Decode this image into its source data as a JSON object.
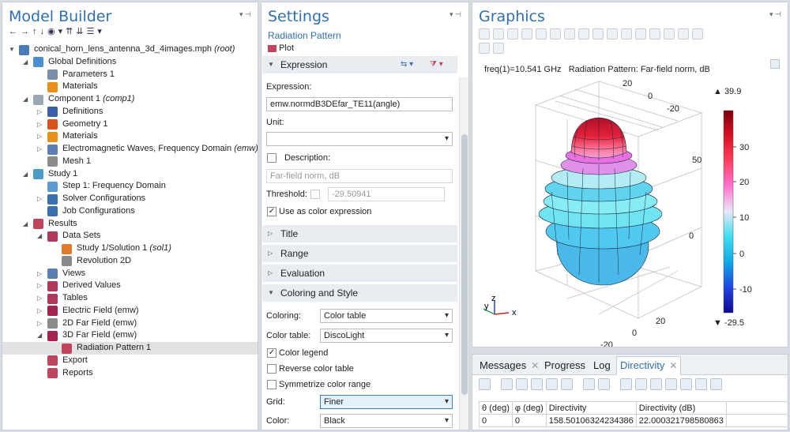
{
  "model_builder": {
    "title": "Model Builder",
    "tree": [
      {
        "indent": 0,
        "tw": "▼",
        "icon": "file-icon",
        "color": "#4a7ab8",
        "label": "conical_horn_lens_antenna_3d_4images.mph",
        "tag": "(root)"
      },
      {
        "indent": 1,
        "tw": "◢",
        "icon": "globe-icon",
        "color": "#4c8fd0",
        "label": "Global Definitions",
        "tag": ""
      },
      {
        "indent": 2,
        "tw": "",
        "icon": "parameters-icon",
        "color": "#7b8fa8",
        "label": "Parameters 1",
        "tag": ""
      },
      {
        "indent": 2,
        "tw": "",
        "icon": "materials-icon",
        "color": "#e8901a",
        "label": "Materials",
        "tag": ""
      },
      {
        "indent": 1,
        "tw": "◢",
        "icon": "component-icon",
        "color": "#9aa7b5",
        "label": "Component 1",
        "tag": "(comp1)"
      },
      {
        "indent": 2,
        "tw": "▷",
        "icon": "definitions-icon",
        "color": "#3c5fa8",
        "label": "Definitions",
        "tag": ""
      },
      {
        "indent": 2,
        "tw": "▷",
        "icon": "geometry-icon",
        "color": "#d9531e",
        "label": "Geometry 1",
        "tag": ""
      },
      {
        "indent": 2,
        "tw": "▷",
        "icon": "materials-icon",
        "color": "#e8901a",
        "label": "Materials",
        "tag": ""
      },
      {
        "indent": 2,
        "tw": "▷",
        "icon": "emw-icon",
        "color": "#5a7fb0",
        "label": "Electromagnetic Waves, Frequency Domain",
        "tag": "(emw)"
      },
      {
        "indent": 2,
        "tw": "",
        "icon": "mesh-icon",
        "color": "#8c8c8c",
        "label": "Mesh 1",
        "tag": ""
      },
      {
        "indent": 1,
        "tw": "◢",
        "icon": "study-icon",
        "color": "#4c9ac8",
        "label": "Study 1",
        "tag": ""
      },
      {
        "indent": 2,
        "tw": "",
        "icon": "step-icon",
        "color": "#5a9ad0",
        "label": "Step 1: Frequency Domain",
        "tag": ""
      },
      {
        "indent": 2,
        "tw": "▷",
        "icon": "solver-icon",
        "color": "#3c6fb0",
        "label": "Solver Configurations",
        "tag": ""
      },
      {
        "indent": 2,
        "tw": "",
        "icon": "job-icon",
        "color": "#3c6fb0",
        "label": "Job Configurations",
        "tag": ""
      },
      {
        "indent": 1,
        "tw": "◢",
        "icon": "results-icon",
        "color": "#c0455c",
        "label": "Results",
        "tag": ""
      },
      {
        "indent": 2,
        "tw": "◢",
        "icon": "datasets-icon",
        "color": "#b0385a",
        "label": "Data Sets",
        "tag": ""
      },
      {
        "indent": 3,
        "tw": "",
        "icon": "solution-icon",
        "color": "#e07a2c",
        "label": "Study 1/Solution 1",
        "tag": "(sol1)"
      },
      {
        "indent": 3,
        "tw": "",
        "icon": "revolution-icon",
        "color": "#8a8a8a",
        "label": "Revolution 2D",
        "tag": ""
      },
      {
        "indent": 2,
        "tw": "▷",
        "icon": "views-icon",
        "color": "#5a7fb0",
        "label": "Views",
        "tag": ""
      },
      {
        "indent": 2,
        "tw": "▷",
        "icon": "derived-icon",
        "color": "#b0385a",
        "label": "Derived Values",
        "tag": ""
      },
      {
        "indent": 2,
        "tw": "▷",
        "icon": "tables-icon",
        "color": "#b0385a",
        "label": "Tables",
        "tag": ""
      },
      {
        "indent": 2,
        "tw": "▷",
        "icon": "plotgroup-icon",
        "color": "#a3224e",
        "label": "Electric Field (emw)",
        "tag": ""
      },
      {
        "indent": 2,
        "tw": "▷",
        "icon": "farfield2d-icon",
        "color": "#8a8a8a",
        "label": "2D Far Field (emw)",
        "tag": ""
      },
      {
        "indent": 2,
        "tw": "◢",
        "icon": "farfield3d-icon",
        "color": "#a3224e",
        "label": "3D Far Field (emw)",
        "tag": ""
      },
      {
        "indent": 3,
        "tw": "",
        "icon": "radiation-icon",
        "color": "#c0455c",
        "label": "Radiation Pattern 1",
        "tag": "",
        "selected": true
      },
      {
        "indent": 2,
        "tw": "",
        "icon": "export-icon",
        "color": "#c0455c",
        "label": "Export",
        "tag": ""
      },
      {
        "indent": 2,
        "tw": "",
        "icon": "reports-icon",
        "color": "#c0455c",
        "label": "Reports",
        "tag": ""
      }
    ]
  },
  "settings": {
    "title": "Settings",
    "subtitle": "Radiation Pattern",
    "plot_label": "Plot",
    "sections": {
      "expression": "Expression",
      "title": "Title",
      "range": "Range",
      "evaluation": "Evaluation",
      "coloring": "Coloring and Style"
    },
    "expression_label": "Expression:",
    "expression_value": "emw.normdB3DEfar_TE11(angle)",
    "unit_label": "Unit:",
    "unit_value": "",
    "description_label": "Description:",
    "description_value": "Far-field norm, dB",
    "threshold_label": "Threshold:",
    "threshold_value": "-29.50941",
    "use_color_expr": "Use as color expression",
    "coloring_label": "Coloring:",
    "coloring_value": "Color table",
    "color_table_label": "Color table:",
    "color_table_value": "DiscoLight",
    "color_legend": "Color legend",
    "reverse_table": "Reverse color table",
    "symmetrize": "Symmetrize color range",
    "grid_label": "Grid:",
    "grid_value": "Finer",
    "color_label": "Color:",
    "color_value": "Black"
  },
  "graphics": {
    "title": "Graphics",
    "header_freq": "freq(1)=10.541 GHz",
    "header_title": "Radiation Pattern: Far-field norm, dB",
    "axis_labels": {
      "top20": "20",
      "top0": "0",
      "topm20": "-20",
      "r50": "50",
      "r0": "0",
      "bot20": "20",
      "bot0": "0",
      "botm20": "-20"
    },
    "triad": {
      "x": "x",
      "y": "y",
      "z": "z"
    },
    "colorbar": {
      "max_label": "▲ 39.9",
      "min_label": "▼ -29.5",
      "ticks": [
        "30",
        "20",
        "10",
        "0",
        "-10"
      ]
    }
  },
  "results_panel": {
    "tabs": [
      "Messages",
      "Progress",
      "Log",
      "Directivity"
    ],
    "active_tab": "Directivity",
    "table_headers": [
      "θ (deg)",
      "φ (deg)",
      "Directivity",
      "Directivity (dB)"
    ],
    "table_rows": [
      [
        "0",
        "0",
        "158.50106324234386",
        "22.000321798580863"
      ]
    ]
  }
}
